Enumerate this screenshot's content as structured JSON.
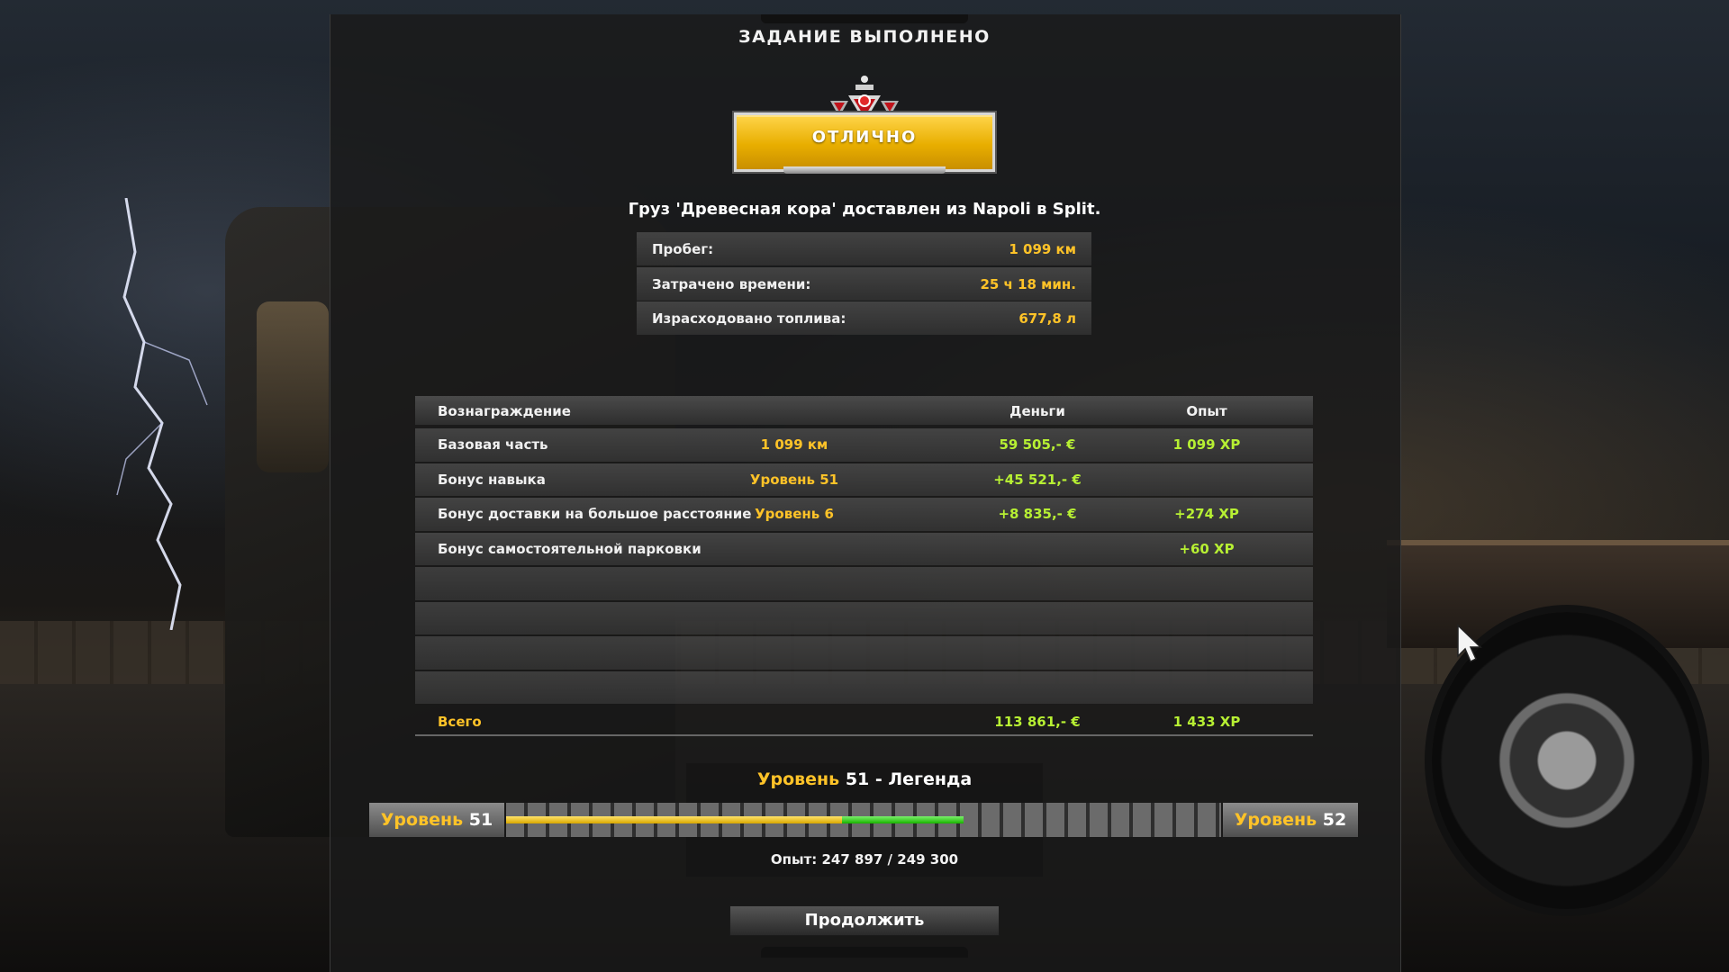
{
  "dialog": {
    "title": "ЗАДАНИЕ ВЫПОЛНЕНО",
    "rating_label": "ОТЛИЧНО",
    "delivery_summary": "Груз 'Древесная кора' доставлен из Napoli в Split."
  },
  "stats": [
    {
      "label": "Пробег:",
      "value": "1 099 км"
    },
    {
      "label": "Затрачено времени:",
      "value": "25 ч 18 мин."
    },
    {
      "label": "Израсходовано топлива:",
      "value": "677,8 л"
    }
  ],
  "rewards": {
    "headers": {
      "name": "Вознаграждение",
      "money": "Деньги",
      "xp": "Опыт"
    },
    "rows": [
      {
        "name": "Базовая часть",
        "detail": "1 099 км",
        "money": "59 505,- €",
        "xp": "1 099 XP"
      },
      {
        "name": "Бонус навыка",
        "detail": "Уровень 51",
        "money": "+45 521,- €",
        "xp": ""
      },
      {
        "name": "Бонус доставки на большое расстояние",
        "detail": "Уровень 6",
        "money": "+8 835,- €",
        "xp": "+274 XP"
      },
      {
        "name": "Бонус самостоятельной парковки",
        "detail": "",
        "money": "",
        "xp": "+60 XP"
      }
    ],
    "total": {
      "name": "Всего",
      "money": "113 861,- €",
      "xp": "1 433 XP"
    }
  },
  "level": {
    "title_word": "Уровень",
    "title_rest": "51 - Легенда",
    "left_word": "Уровень",
    "left_num": "51",
    "right_word": "Уровень",
    "right_num": "52",
    "progress_before": 0.47,
    "progress_after": 0.64,
    "xp_text": "Опыт: 247 897 / 249 300"
  },
  "continue_label": "Продолжить",
  "colors": {
    "accent_yellow": "#ffc328",
    "money_green": "#b7f033",
    "progress_gain": "#19b300",
    "badge_gold": "#e8ae00"
  }
}
